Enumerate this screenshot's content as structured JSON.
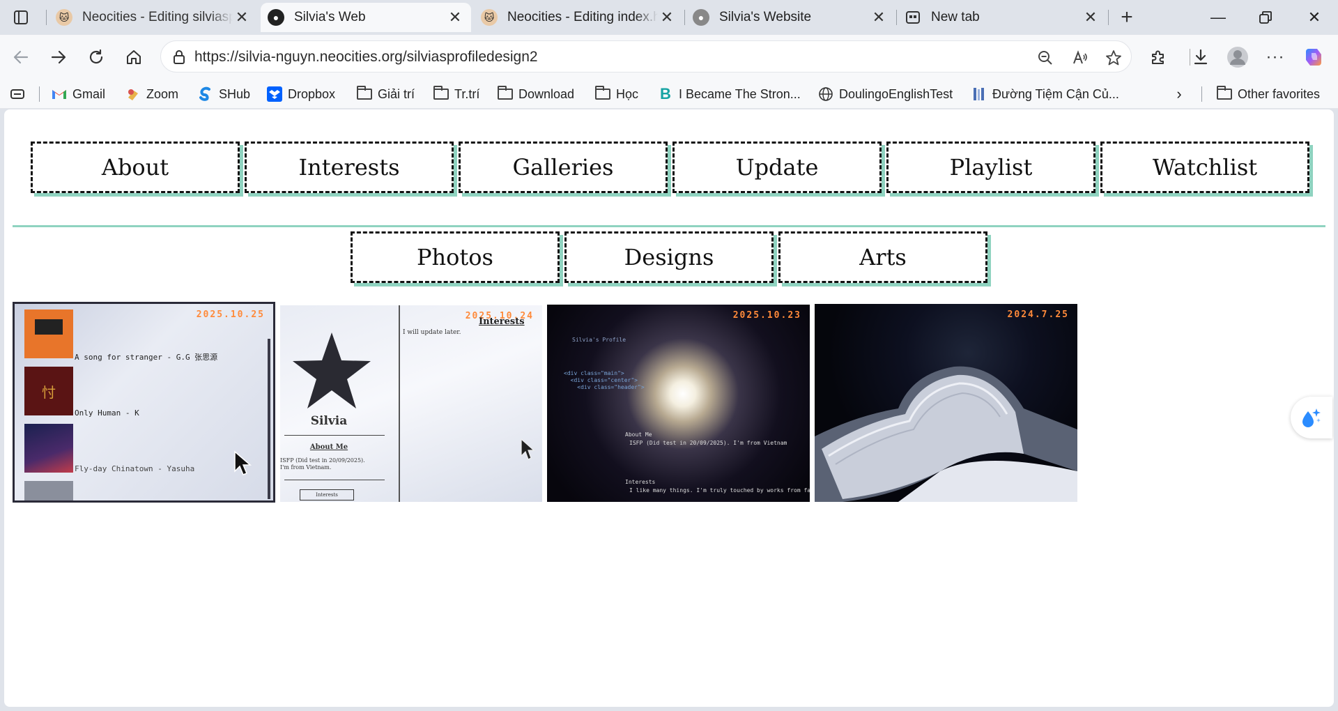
{
  "browser": {
    "tabs": [
      {
        "title": "Neocities - Editing silviasprofiledesign2",
        "active": false
      },
      {
        "title": "Silvia's Web",
        "active": true
      },
      {
        "title": "Neocities - Editing index.html",
        "active": false
      },
      {
        "title": "Silvia's Website",
        "active": false
      },
      {
        "title": "New tab",
        "active": false
      }
    ],
    "url": "https://silvia-nguyn.neocities.org/silviasprofiledesign2",
    "favorites": [
      {
        "label": "Gmail",
        "icon": "gmail-icon"
      },
      {
        "label": "Zoom",
        "icon": "zoom-icon"
      },
      {
        "label": "SHub",
        "icon": "shub-icon"
      },
      {
        "label": "Dropbox",
        "icon": "dropbox-icon"
      },
      {
        "label": "Giải trí",
        "icon": "folder-icon"
      },
      {
        "label": "Tr.trí",
        "icon": "folder-icon"
      },
      {
        "label": "Download",
        "icon": "folder-icon"
      },
      {
        "label": "Học",
        "icon": "folder-icon"
      },
      {
        "label": "I Became The Stron...",
        "icon": "bookmark-b-icon"
      },
      {
        "label": "DoulingoEnglishTest",
        "icon": "globe-icon"
      },
      {
        "label": "Đường Tiệm Cận Củ...",
        "icon": "bookmark-icon"
      }
    ],
    "other_favorites": "Other favorites"
  },
  "page": {
    "main_nav": [
      "About",
      "Interests",
      "Galleries",
      "Update",
      "Playlist",
      "Watchlist"
    ],
    "sub_nav": [
      "Photos",
      "Designs",
      "Arts"
    ],
    "photos": [
      {
        "date": "2025.10.25",
        "lines": [
          "A song for stranger - G.G 张思源",
          "Only Human - K",
          "Fly-day Chinatown - Yasuha"
        ]
      },
      {
        "date": "2025.10.24",
        "heading": "Interests",
        "note": "I will update later.",
        "name": "Silvia",
        "about": "About Me",
        "about_text": "ISFP (Did test in 20/09/2025). I'm from Vietnam.",
        "button": "Interests"
      },
      {
        "date": "2025.10.23",
        "code_title": "Silvia's Profile",
        "code_about": "About Me",
        "code_text": "ISFP (Did test in 20/09/2025). I'm from Vietnam",
        "code_interests": "Interests",
        "code_more": "I like many things. I'm truly touched by works from fashion"
      },
      {
        "date": "2024.7.25"
      }
    ],
    "colors": {
      "accent_shadow": "#8fd3c0",
      "border": "#111111",
      "stamp": "#ff8a3a"
    }
  }
}
